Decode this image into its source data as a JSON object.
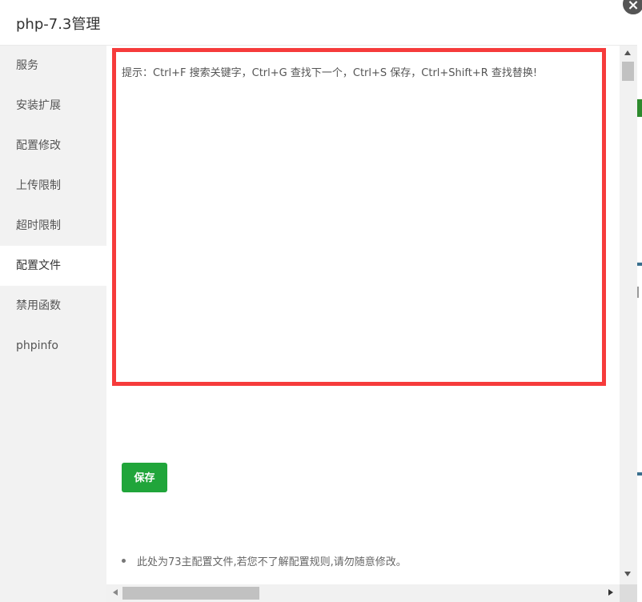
{
  "dialog": {
    "title": "php-7.3管理",
    "close_label": "×"
  },
  "sidebar": {
    "items": [
      {
        "label": "服务"
      },
      {
        "label": "安装扩展"
      },
      {
        "label": "配置修改"
      },
      {
        "label": "上传限制"
      },
      {
        "label": "超时限制"
      },
      {
        "label": "配置文件",
        "active": true
      },
      {
        "label": "禁用函数"
      },
      {
        "label": "phpinfo"
      }
    ]
  },
  "editor": {
    "hint": "提示：Ctrl+F 搜索关键字，Ctrl+G 查找下一个，Ctrl+S 保存，Ctrl+Shift+R 查找替换!",
    "highlight_color": "#f63b3b"
  },
  "actions": {
    "save_label": "保存",
    "save_color": "#20a53a"
  },
  "notes": [
    "此处为73主配置文件,若您不了解配置规则,请勿随意修改。"
  ]
}
